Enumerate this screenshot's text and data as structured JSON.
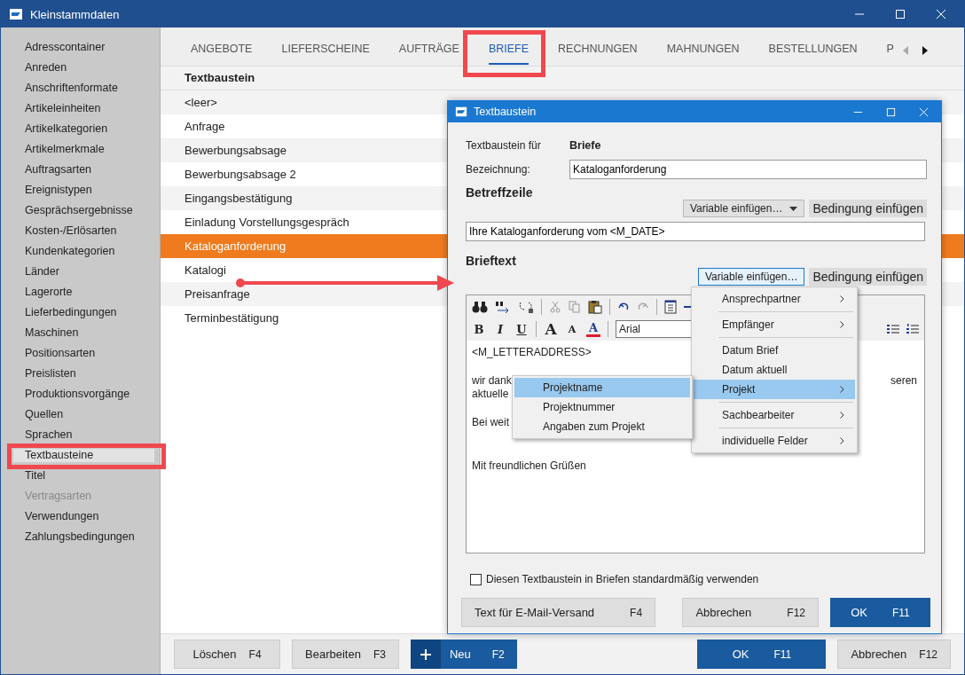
{
  "window": {
    "title": "Kleinstammdaten"
  },
  "sidebar": {
    "items": [
      {
        "label": "Adresscontainer",
        "selected": false,
        "disabled": false
      },
      {
        "label": "Anreden",
        "selected": false,
        "disabled": false
      },
      {
        "label": "Anschriftenformate",
        "selected": false,
        "disabled": false
      },
      {
        "label": "Artikeleinheiten",
        "selected": false,
        "disabled": false
      },
      {
        "label": "Artikelkategorien",
        "selected": false,
        "disabled": false
      },
      {
        "label": "Artikelmerkmale",
        "selected": false,
        "disabled": false
      },
      {
        "label": "Auftragsarten",
        "selected": false,
        "disabled": false
      },
      {
        "label": "Ereignistypen",
        "selected": false,
        "disabled": false
      },
      {
        "label": "Gesprächsergebnisse",
        "selected": false,
        "disabled": false
      },
      {
        "label": "Kosten-/Erlösarten",
        "selected": false,
        "disabled": false
      },
      {
        "label": "Kundenkategorien",
        "selected": false,
        "disabled": false
      },
      {
        "label": "Länder",
        "selected": false,
        "disabled": false
      },
      {
        "label": "Lagerorte",
        "selected": false,
        "disabled": false
      },
      {
        "label": "Lieferbedingungen",
        "selected": false,
        "disabled": false
      },
      {
        "label": "Maschinen",
        "selected": false,
        "disabled": false
      },
      {
        "label": "Positionsarten",
        "selected": false,
        "disabled": false
      },
      {
        "label": "Preislisten",
        "selected": false,
        "disabled": false
      },
      {
        "label": "Produktionsvorgänge",
        "selected": false,
        "disabled": false
      },
      {
        "label": "Quellen",
        "selected": false,
        "disabled": false
      },
      {
        "label": "Sprachen",
        "selected": false,
        "disabled": false
      },
      {
        "label": "Textbausteine",
        "selected": true,
        "disabled": false
      },
      {
        "label": "Titel",
        "selected": false,
        "disabled": false
      },
      {
        "label": "Vertragsarten",
        "selected": false,
        "disabled": true
      },
      {
        "label": "Verwendungen",
        "selected": false,
        "disabled": false
      },
      {
        "label": "Zahlungsbedingungen",
        "selected": false,
        "disabled": false
      }
    ]
  },
  "tabs": [
    {
      "label": "ANGEBOTE",
      "selected": false
    },
    {
      "label": "LIEFERSCHEINE",
      "selected": false
    },
    {
      "label": "AUFTRÄGE",
      "selected": false
    },
    {
      "label": "BRIEFE",
      "selected": true
    },
    {
      "label": "RECHNUNGEN",
      "selected": false
    },
    {
      "label": "MAHNUNGEN",
      "selected": false
    },
    {
      "label": "BESTELLUNGEN",
      "selected": false
    },
    {
      "label": "P",
      "selected": false
    }
  ],
  "list": {
    "header": "Textbaustein",
    "rows": [
      {
        "label": "<leer>",
        "selected": false
      },
      {
        "label": "Anfrage",
        "selected": false
      },
      {
        "label": "Bewerbungsabsage",
        "selected": false
      },
      {
        "label": "Bewerbungsabsage 2",
        "selected": false
      },
      {
        "label": "Eingangsbestätigung",
        "selected": false
      },
      {
        "label": "Einladung Vorstellungsgespräch",
        "selected": false
      },
      {
        "label": "Kataloganforderung",
        "selected": true
      },
      {
        "label": "Katalogi",
        "selected": false
      },
      {
        "label": "Preisanfrage",
        "selected": false
      },
      {
        "label": "Terminbestätigung",
        "selected": false
      }
    ]
  },
  "bottom_buttons": [
    {
      "label": "Löschen",
      "shortcut": "F4",
      "kind": "plain"
    },
    {
      "label": "Bearbeiten",
      "shortcut": "F3",
      "kind": "plain"
    },
    {
      "label": "Neu",
      "shortcut": "F2",
      "kind": "new"
    },
    {
      "label": "OK",
      "shortcut": "F11",
      "kind": "primary"
    },
    {
      "label": "Abbrechen",
      "shortcut": "F12",
      "kind": "plain"
    }
  ],
  "dialog": {
    "title": "Textbaustein",
    "for_label": "Textbaustein für",
    "for_value": "Briefe",
    "name_label": "Bezeichnung:",
    "name_value": "Kataloganforderung",
    "subject": {
      "heading": "Betreffzeile",
      "variable_button": "Variable einfügen…",
      "condition_button": "Bedingung einfügen",
      "value": "Ihre Kataloganforderung vom <M_DATE>"
    },
    "body": {
      "heading": "Brieftext",
      "variable_button": "Variable einfügen…",
      "condition_button": "Bedingung einfügen",
      "font": "Arial",
      "format_buttons": [
        {
          "label": "B",
          "kind": "bold"
        },
        {
          "label": "I",
          "kind": "italic"
        },
        {
          "label": "U",
          "kind": "underline"
        },
        {
          "label": "A",
          "kind": "grow"
        },
        {
          "label": "A",
          "kind": "shrink"
        },
        {
          "label": "A",
          "kind": "color"
        }
      ],
      "paragraphs": [
        [
          {
            "text": "<M_LETTERADDRESS>"
          }
        ],
        [
          {
            "text": "wir dank",
            "tail": "seren"
          },
          {
            "text": "aktuelle"
          }
        ],
        [
          {
            "text": "Bei weit"
          }
        ],
        [
          {
            "text": "Mit freundlichen Grüßen"
          }
        ]
      ]
    },
    "checkbox": {
      "label": "Diesen Textbaustein in Briefen standardmäßig verwenden",
      "checked": false
    },
    "buttons": [
      {
        "label": "Text für E-Mail-Versand",
        "shortcut": "F4",
        "kind": "plain"
      },
      {
        "label": "Abbrechen",
        "shortcut": "F12",
        "kind": "plain"
      },
      {
        "label": "OK",
        "shortcut": "F11",
        "kind": "primary"
      }
    ]
  },
  "variable_menu": {
    "groups": [
      [
        {
          "label": "Ansprechpartner",
          "has_submenu": true,
          "selected": false
        }
      ],
      [
        {
          "label": "Empfänger",
          "has_submenu": true,
          "selected": false
        }
      ],
      [
        {
          "label": "Datum Brief",
          "has_submenu": false,
          "selected": false
        },
        {
          "label": "Datum aktuell",
          "has_submenu": false,
          "selected": false
        },
        {
          "label": "Projekt",
          "has_submenu": true,
          "selected": true
        }
      ],
      [
        {
          "label": "Sachbearbeiter",
          "has_submenu": true,
          "selected": false
        }
      ],
      [
        {
          "label": "individuelle Felder",
          "has_submenu": true,
          "selected": false
        }
      ]
    ]
  },
  "submenu": {
    "items": [
      {
        "label": "Projektname",
        "selected": true
      },
      {
        "label": "Projektnummer",
        "selected": false
      },
      {
        "label": "Angaben zum Projekt",
        "selected": false
      }
    ]
  }
}
